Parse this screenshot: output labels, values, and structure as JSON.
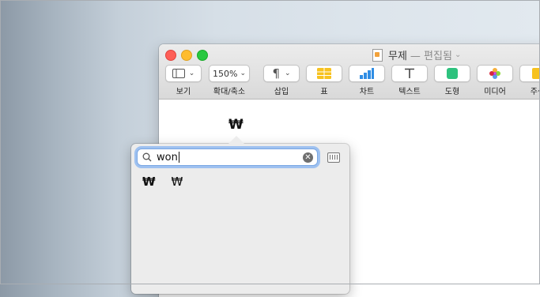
{
  "window": {
    "title": "무제",
    "edited": "— 편집됨"
  },
  "toolbar": {
    "view_label": "보기",
    "zoom_value": "150%",
    "zoom_label": "확대/축소",
    "insert_label": "삽입",
    "table_label": "표",
    "chart_label": "차트",
    "text_label": "텍스트",
    "shape_label": "도형",
    "media_label": "미디어",
    "comment_label": "주석"
  },
  "document": {
    "inserted_char": "₩"
  },
  "char_viewer": {
    "search_value": "won",
    "results": [
      "₩",
      "₩"
    ]
  },
  "colors": {
    "table_icon": "#f7c21f",
    "chart_icon": "#2f8de4",
    "shape_icon": "#2ec27e",
    "focus_ring": "#9ec1f0"
  }
}
